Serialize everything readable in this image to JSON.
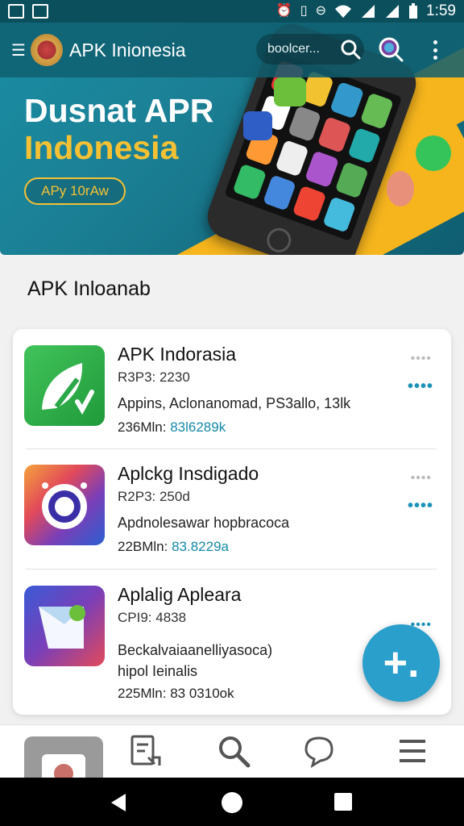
{
  "status_bar": {
    "time": "1:59"
  },
  "header": {
    "title": "APK Inionesia",
    "search_placeholder": "boolcer..."
  },
  "hero": {
    "headline_line1": "Dusnat APR",
    "headline_line2": "Indonesia",
    "button_label": "APy 10rAw"
  },
  "section": {
    "title": "APK Inloanab"
  },
  "apps": [
    {
      "title": "APK Indorasia",
      "subtitle": "R3P3: 2230",
      "description": "Appins, Aclonanomad, PS3allo, 13lk",
      "stats_prefix": "236Mln: ",
      "stats_value": "83l6289k"
    },
    {
      "title": "Aplckg Insdigado",
      "subtitle": "R2P3: 250d",
      "description": "Apdnolesawar hopbracoca",
      "stats_prefix": "22BMln: ",
      "stats_value": "83.8229a"
    },
    {
      "title": "Aplalig Apleara",
      "subtitle": "CPI9: 4838",
      "description": "Beckalvaiaanelliyasoca)",
      "description2": "hipol Ieinalis",
      "stats_prefix": "225Mln: ",
      "stats_value": "83 0310ok"
    }
  ],
  "fab": {
    "label": "+."
  },
  "colors": {
    "accent": "#2a9fcc",
    "header": "#0f5d70",
    "highlight": "#f5c134"
  }
}
